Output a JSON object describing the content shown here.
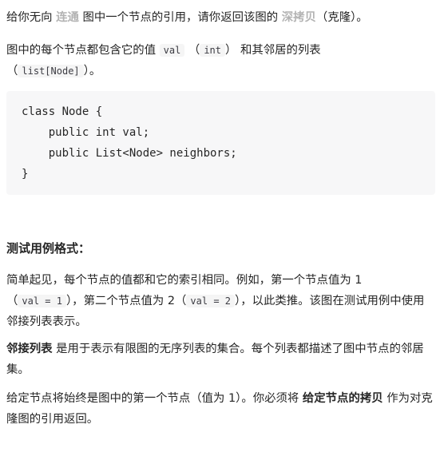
{
  "intro": {
    "t1": "给你无向 ",
    "link_connected": "连通",
    "t2": " 图中一个节点的引用，请你返回该图的 ",
    "link_deep_copy": "深拷贝",
    "t3": "（克隆）。"
  },
  "node_desc": {
    "t1": "图中的每个节点都包含它的值 ",
    "code_val": "val",
    "t2": " （",
    "code_int": "int",
    "t3": "） 和其邻居的列表",
    "t4": "（",
    "code_list": "list[Node]",
    "t5": "）。"
  },
  "code_block": {
    "lines": [
      "class Node {",
      "    public int val;",
      "    public List<Node> neighbors;",
      "}"
    ]
  },
  "test_heading": "测试用例格式：",
  "simple_para": {
    "t1": "简单起见，每个节点的值都和它的索引相同。例如，第一个节点值为 1",
    "t2": "（",
    "code_val1": "val = 1",
    "t3": "），第二个节点值为 2（",
    "code_val2": "val = 2",
    "t4": "），以此类推。该图在测试用例中使用邻接列表表示。"
  },
  "adjacency_para": {
    "bold": "邻接列表",
    "t1": " 是用于表示有限图的无序列表的集合。每个列表都描述了图中节点的邻居集。"
  },
  "given_para": {
    "t1": "给定节点将始终是图中的第一个节点（值为 1）。你必须将 ",
    "bold": "给定节点的拷贝",
    "t2": " 作为对克隆图的引用返回。"
  }
}
